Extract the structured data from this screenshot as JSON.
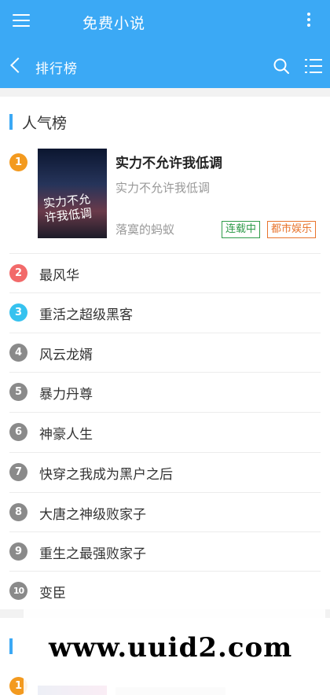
{
  "app_bar": {
    "title": "免费小说",
    "menu_icon": "hamburger-menu-icon",
    "more_icon": "more-vertical-icon"
  },
  "sub_bar": {
    "title": "排行榜",
    "back_icon": "back-arrow-icon",
    "search_icon": "search-icon",
    "list_icon": "list-icon"
  },
  "colors": {
    "primary": "#3ba9f5",
    "rank1": "#f39a1f",
    "rank2": "#f26a6a",
    "rank3": "#36c2ef",
    "rank_other": "#8a8a8a",
    "status_tag": "#2e9b4a",
    "category_tag": "#e8742d"
  },
  "section": {
    "title": "人气榜",
    "top_book": {
      "rank": "1",
      "title": "实力不允许我低调",
      "description": "实力不允许我低调",
      "author": "落寞的蚂蚁",
      "status_tag": "连载中",
      "category_tag": "都市娱乐",
      "cover_text": "实力不允许我低调"
    },
    "items": [
      {
        "rank": "2",
        "title": "最风华"
      },
      {
        "rank": "3",
        "title": "重活之超级黑客"
      },
      {
        "rank": "4",
        "title": "风云龙婿"
      },
      {
        "rank": "5",
        "title": "暴力丹尊"
      },
      {
        "rank": "6",
        "title": "神豪人生"
      },
      {
        "rank": "7",
        "title": "快穿之我成为黑户之后"
      },
      {
        "rank": "8",
        "title": "大唐之神级败家子"
      },
      {
        "rank": "9",
        "title": "重生之最强败家子"
      },
      {
        "rank": "10",
        "title": "变臣"
      }
    ]
  },
  "next_section": {
    "rank": "1"
  },
  "watermark": {
    "text": "www.uuid2.com"
  }
}
